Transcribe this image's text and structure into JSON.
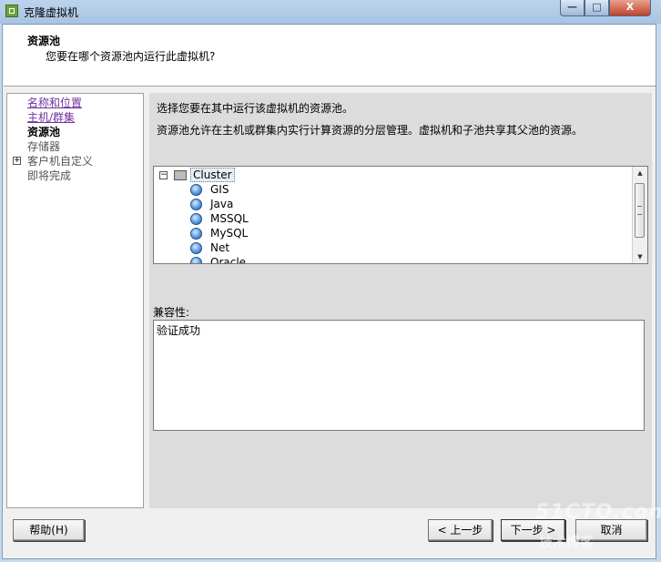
{
  "window": {
    "title": "克隆虚拟机"
  },
  "header": {
    "title": "资源池",
    "subtitle": "您要在哪个资源池内运行此虚拟机?"
  },
  "sidebar": {
    "items": [
      {
        "label": "名称和位置",
        "state": "link"
      },
      {
        "label": "主机/群集",
        "state": "link"
      },
      {
        "label": "资源池",
        "state": "current"
      },
      {
        "label": "存储器",
        "state": "pending"
      },
      {
        "label": "客户机自定义",
        "state": "pending",
        "expander": "+"
      },
      {
        "label": "即将完成",
        "state": "pending"
      }
    ]
  },
  "main": {
    "description1": "选择您要在其中运行该虚拟机的资源池。",
    "description2": "资源池允许在主机或群集内实行计算资源的分层管理。虚拟机和子池共享其父池的资源。",
    "tree": {
      "collapse_glyph": "−",
      "root": "Cluster",
      "children": [
        "GIS",
        "Java",
        "MSSQL",
        "MySQL",
        "Net",
        "Oracle"
      ]
    },
    "compatibility_label": "兼容性:",
    "compatibility_value": "验证成功"
  },
  "buttons": {
    "help": "帮助(H)",
    "back": "< 上一步",
    "next": "下一步 >",
    "cancel": "取消"
  },
  "titlebar_buttons": {
    "minimize": "—",
    "maximize": "□",
    "close": "X"
  },
  "watermark": {
    "line1": "51CTO.com",
    "line2": "技术博客"
  }
}
